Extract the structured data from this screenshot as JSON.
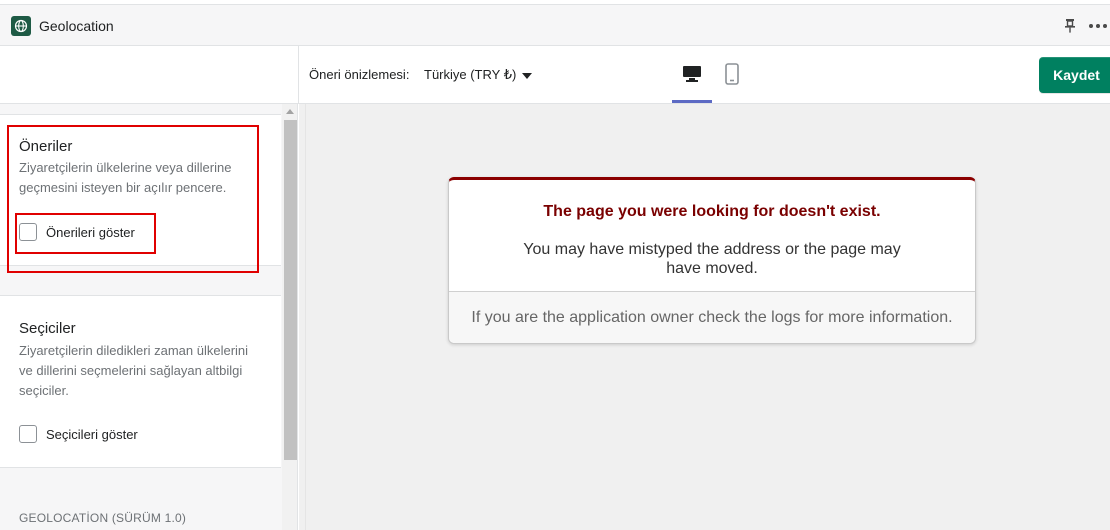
{
  "app": {
    "title": "Geolocation",
    "icon": "globe-icon",
    "brand_color": "#1e5a45"
  },
  "toolbar": {
    "preview_label": "Öneri önizlemesi:",
    "preview_value": "Türkiye (TRY ₺)",
    "devices": [
      "desktop-icon",
      "mobile-icon"
    ],
    "active_device": "desktop",
    "save_label": "Kaydet",
    "save_color": "#008060"
  },
  "sidebar": {
    "sections": [
      {
        "title": "Öneriler",
        "description": "Ziyaretçilerin ülkelerine veya dillerine geçmesini isteyen bir açılır pencere.",
        "checkbox_label": "Önerileri göster",
        "checked": false
      },
      {
        "title": "Seçiciler",
        "description": "Ziyaretçilerin diledikleri zaman ülkelerini ve dillerini seçmelerini sağlayan altbilgi seçiciler.",
        "checkbox_label": "Seçicileri göster",
        "checked": false
      }
    ],
    "version": "GEOLOCATİON (SÜRÜM 1.0)"
  },
  "preview": {
    "error_title": "The page you were looking for doesn't exist.",
    "error_message": "You may have mistyped the address or the page may have moved.",
    "error_footer": "If you are the application owner check the logs for more information."
  },
  "highlight_color": "#e00000"
}
